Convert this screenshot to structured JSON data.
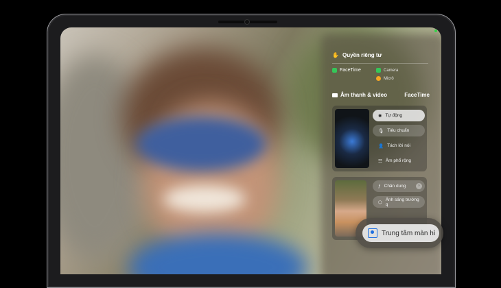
{
  "privacy": {
    "title": "Quyền riêng tư",
    "app": "FaceTime",
    "camera": "Camera",
    "mic": "Micrô",
    "colors": {
      "active": "#35c759",
      "mic": "#f5a623"
    }
  },
  "audio_video": {
    "title": "Âm thanh & video",
    "app": "FaceTime",
    "mic_modes": [
      "Tự động",
      "Tiêu chuẩn",
      "Tách lời nói",
      "Âm phổ rộng"
    ],
    "selected_mic_mode": "Tự động"
  },
  "video_effects": [
    "Chân dung",
    "Ánh sáng trường q"
  ],
  "popup": {
    "label": "Trung tâm màn hì"
  }
}
